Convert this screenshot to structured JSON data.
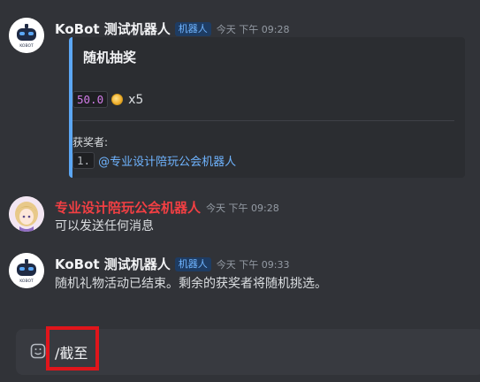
{
  "messages": [
    {
      "author": "KoBot 测试机器人",
      "badge": "机器人",
      "timestamp": "今天 下午 09:28",
      "avatar": "robot-avatar",
      "embed": {
        "title": "随机抽奖",
        "prize_amount": "50.0",
        "prize_icon": "coin-icon",
        "prize_multiplier": "x5",
        "winners_label": "获奖者:",
        "winner_index": "1.",
        "winner_mention": "@专业设计陪玩公会机器人",
        "accent_color": "#5ca7f5"
      }
    },
    {
      "author": "专业设计陪玩公会机器人",
      "timestamp": "今天 下午 09:28",
      "avatar": "anime-girl-avatar",
      "text": "可以发送任何消息",
      "author_color": "#f23f43"
    },
    {
      "author": "KoBot 测试机器人",
      "badge": "机器人",
      "timestamp": "今天 下午 09:33",
      "avatar": "robot-avatar",
      "text": "随机礼物活动已结束。剩余的获奖者将随机挑选。"
    }
  ],
  "composer": {
    "value": "/截至",
    "icon": "emoji-upload-icon"
  },
  "annotation": {
    "highlight_color": "#e0151b"
  }
}
